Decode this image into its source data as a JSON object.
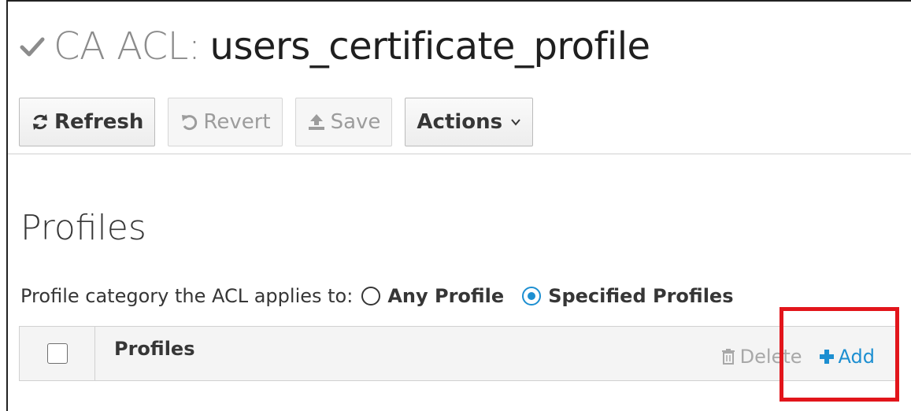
{
  "header": {
    "crumb": "CA ACL:",
    "name": "users_certificate_profile"
  },
  "toolbar": {
    "refresh_label": "Refresh",
    "revert_label": "Revert",
    "save_label": "Save",
    "actions_label": "Actions"
  },
  "section": {
    "title": "Profiles",
    "category_label": "Profile category the ACL applies to:",
    "options": [
      {
        "label": "Any Profile",
        "selected": false
      },
      {
        "label": "Specified Profiles",
        "selected": true
      }
    ]
  },
  "table": {
    "column_header": "Profiles",
    "delete_label": "Delete",
    "add_label": "Add"
  },
  "colors": {
    "accent": "#1d8fd1",
    "highlight": "#e2151b"
  },
  "icons": {
    "title": "check-icon",
    "refresh": "refresh-icon",
    "revert": "undo-icon",
    "save": "upload-icon",
    "actions": "chevron-down-icon",
    "delete": "trash-icon",
    "add": "plus-icon"
  }
}
